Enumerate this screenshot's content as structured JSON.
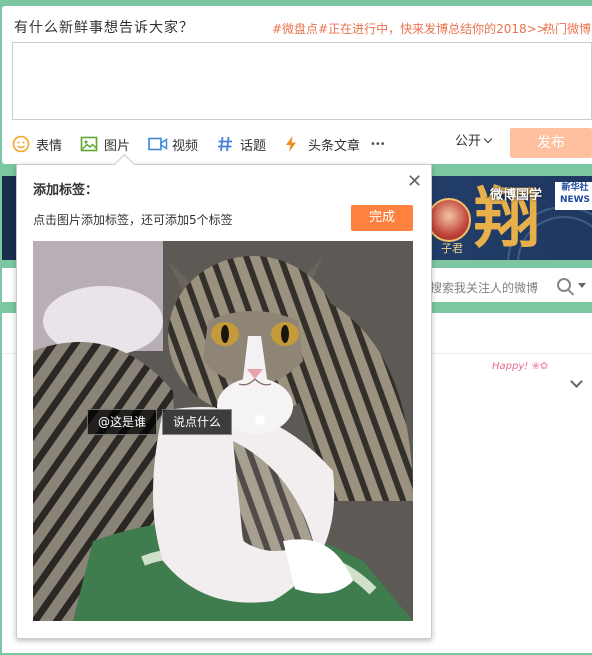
{
  "composer": {
    "prompt": "有什么新鲜事想告诉大家？",
    "topic_link": "#微盘点#正在进行中，快来发博总结你的2018>>",
    "hot_link": "热门微博",
    "toolbar": {
      "emoji": "表情",
      "image": "图片",
      "video": "视频",
      "topic": "话题",
      "article": "头条文章",
      "more": "•••"
    },
    "privacy": "公开",
    "post": "发布"
  },
  "banner": {
    "tag": "微博国学",
    "xinhua": "新华社\nNEWS",
    "char": "翔",
    "name": "子君"
  },
  "search": {
    "placeholder": "搜索我关注人的微博"
  },
  "feed": {
    "sticker": "Happy!"
  },
  "popup": {
    "title": "添加标签：",
    "close": "✕",
    "hint": "点击图片添加标签，还可添加5个标签",
    "done": "完成",
    "tags": [
      "@这是谁",
      "说点什么"
    ]
  },
  "colors": {
    "accent_orange": "#ff8140",
    "post_disabled": "#ffc09f",
    "topic_link": "#eb7350",
    "theme_green": "#7cc7a1"
  }
}
